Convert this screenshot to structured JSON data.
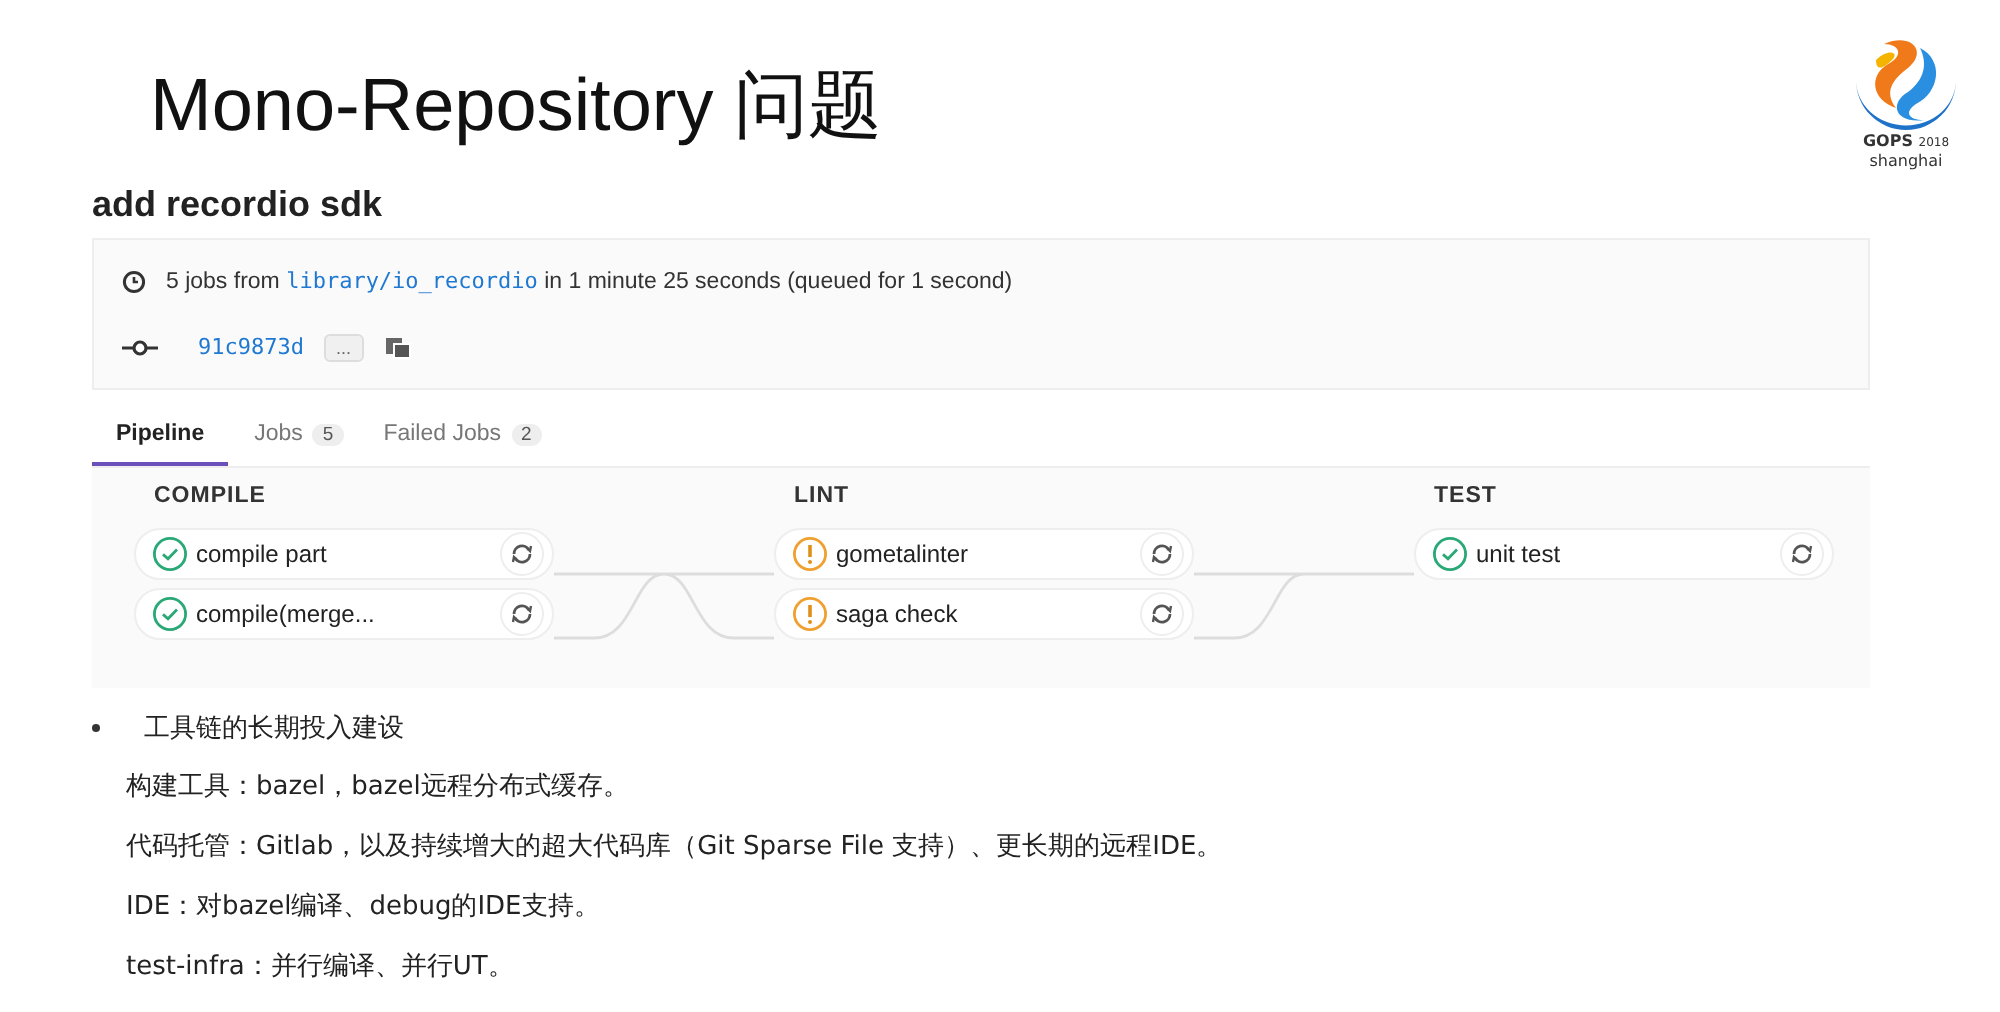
{
  "slide": {
    "title": "Mono-Repository 问题",
    "logo": {
      "event": "GOPS",
      "year": "2018",
      "city": "shanghai"
    }
  },
  "pipeline_page": {
    "title": "add recordio sdk",
    "summary": {
      "before": "5 jobs from",
      "link": "library/io_recordio",
      "after": "in 1 minute 25 seconds (queued for 1 second)"
    },
    "commit": {
      "sha": "91c9873d",
      "more": "..."
    },
    "tabs": [
      {
        "label": "Pipeline",
        "selected": true
      },
      {
        "label": "Jobs",
        "count": "5",
        "selected": false
      },
      {
        "label": "Failed Jobs",
        "count": "2",
        "selected": false
      }
    ],
    "stages": [
      {
        "name": "COMPILE",
        "jobs": [
          {
            "name": "compile part",
            "kind": "passed"
          },
          {
            "name": "compile(merge...",
            "kind": "passed"
          }
        ]
      },
      {
        "name": "LINT",
        "jobs": [
          {
            "name": "gometalinter",
            "kind": "warned"
          },
          {
            "name": "saga check",
            "kind": "warned"
          }
        ]
      },
      {
        "name": "TEST",
        "jobs": [
          {
            "name": "unit test",
            "kind": "passed"
          }
        ]
      }
    ]
  },
  "bullets": [
    {
      "text": "工具链的长期投入建设",
      "children": [
        {
          "text": "构建工具：bazel，bazel远程分布式缓存。"
        },
        {
          "text": "代码托管：Gitlab，以及持续增大的超大代码库（Git Sparse File 支持）、更长期的远程IDE。"
        },
        {
          "text": "IDE：对bazel编译、debug的IDE支持。"
        },
        {
          "text": "test-infra：并行编译、并行UT。"
        }
      ]
    }
  ]
}
